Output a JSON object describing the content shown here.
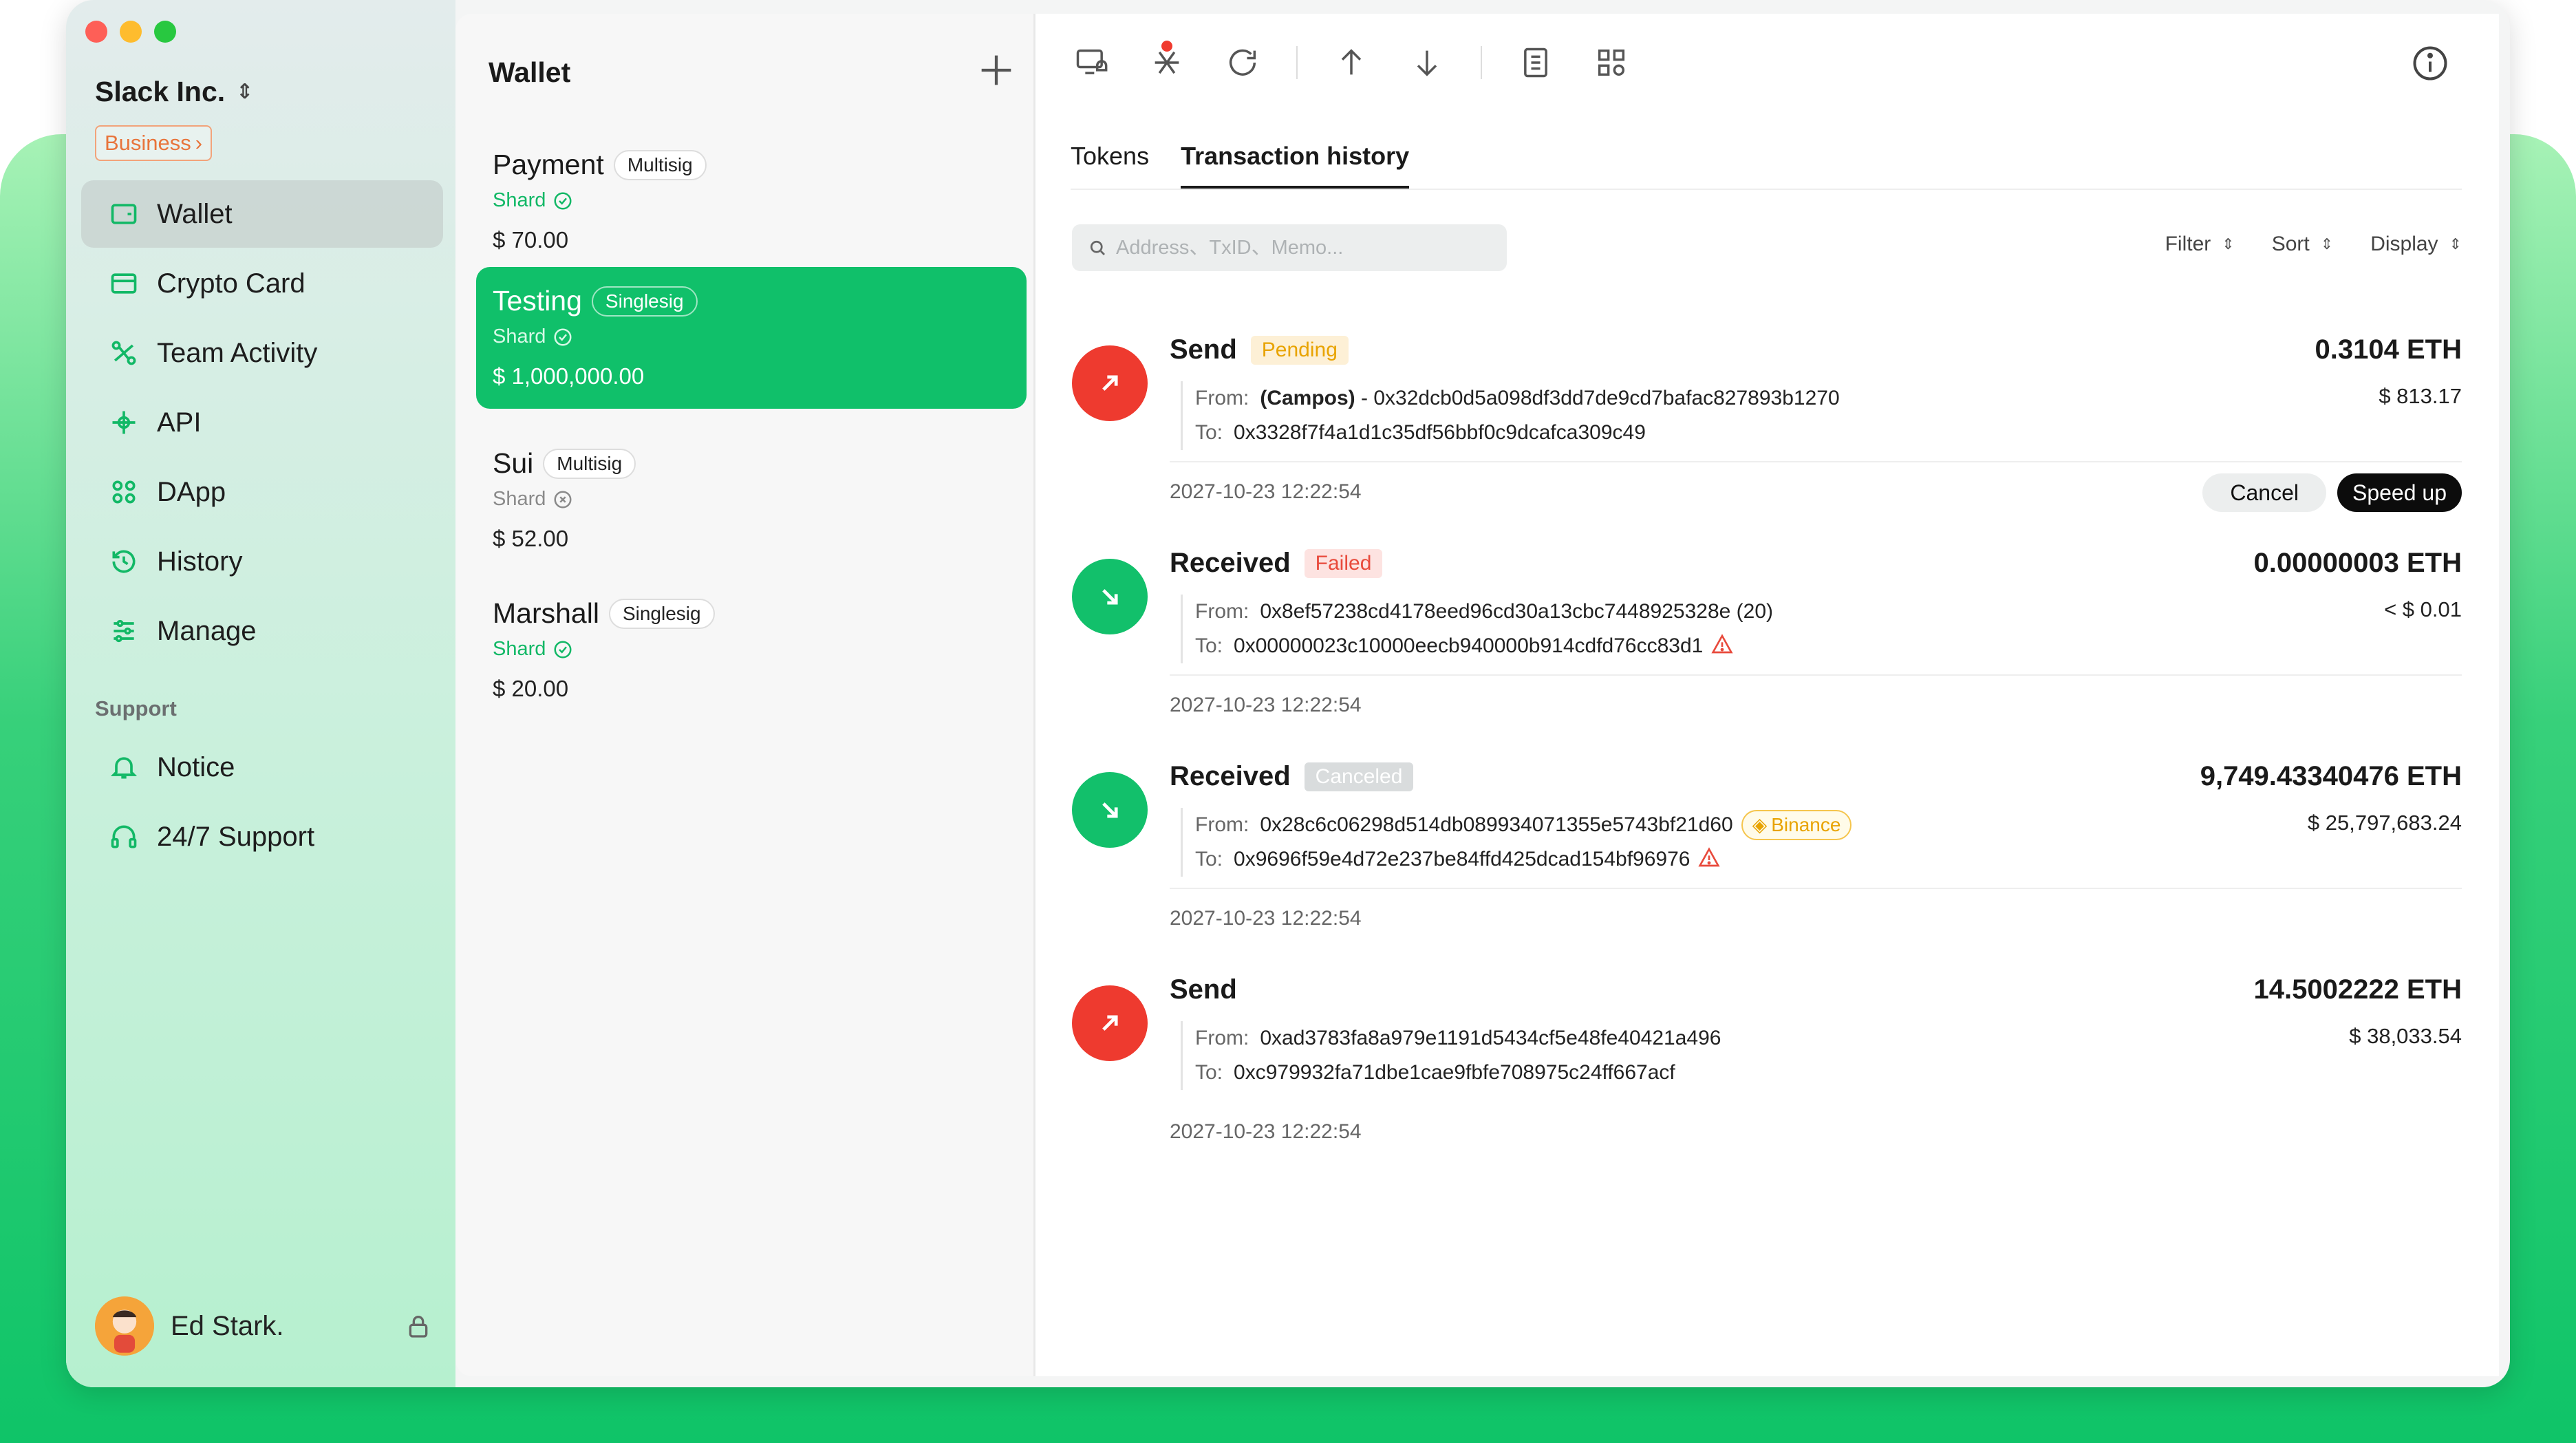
{
  "org": {
    "name": "Slack Inc.",
    "plan": "Business"
  },
  "sidebar": {
    "items": [
      {
        "label": "Wallet",
        "icon": "wallet-icon"
      },
      {
        "label": "Crypto Card",
        "icon": "card-icon"
      },
      {
        "label": "Team Activity",
        "icon": "team-activity-icon"
      },
      {
        "label": "API",
        "icon": "api-icon"
      },
      {
        "label": "DApp",
        "icon": "dapp-icon"
      },
      {
        "label": "History",
        "icon": "history-icon"
      },
      {
        "label": "Manage",
        "icon": "manage-icon"
      }
    ],
    "support_label": "Support",
    "support_items": [
      {
        "label": "Notice",
        "icon": "bell-icon"
      },
      {
        "label": "24/7 Support",
        "icon": "headset-icon"
      }
    ],
    "user": {
      "name": "Ed Stark."
    }
  },
  "wallet_panel": {
    "title": "Wallet",
    "wallets": [
      {
        "name": "Payment",
        "type": "Multisig",
        "shard": "Shard",
        "amount": "$ 70.00"
      },
      {
        "name": "Testing",
        "type": "Singlesig",
        "shard": "Shard",
        "amount": "$ 1,000,000.00"
      },
      {
        "name": "Sui",
        "type": "Multisig",
        "shard": "Shard",
        "amount": "$ 52.00"
      },
      {
        "name": "Marshall",
        "type": "Singlesig",
        "shard": "Shard",
        "amount": "$ 20.00"
      }
    ]
  },
  "main": {
    "tabs": [
      "Tokens",
      "Transaction history"
    ],
    "search_placeholder": "Address、TxID、Memo...",
    "controls": [
      "Filter",
      "Sort",
      "Display"
    ],
    "transactions": [
      {
        "type": "Send",
        "status": "Pending",
        "from_label": "From:",
        "from_name": "(Campos)",
        "from": "- 0x32dcb0d5a098df3dd7de9cd7bafac827893b1270",
        "to_label": "To:",
        "to": "0x3328f7f4a1d1c35df56bbf0c9dcafca309c49",
        "amount": "0.3104 ETH",
        "fiat": "$ 813.17",
        "time": "2027-10-23  12:22:54",
        "cancel_label": "Cancel",
        "speed_label": "Speed up"
      },
      {
        "type": "Received",
        "status": "Failed",
        "from_label": "From:",
        "from": "0x8ef57238cd4178eed96cd30a13cbc7448925328e (20)",
        "to_label": "To:",
        "to": "0x00000023c10000eecb940000b914cdfd76cc83d1",
        "amount": "0.00000003 ETH",
        "fiat": "< $ 0.01",
        "time": "2027-10-23  12:22:54"
      },
      {
        "type": "Received",
        "status": "Canceled",
        "from_label": "From:",
        "from": "0x28c6c06298d514db089934071355e5743bf21d60",
        "exchange": "Binance",
        "to_label": "To:",
        "to": "0x9696f59e4d72e237be84ffd425dcad154bf96976",
        "amount": "9,749.43340476 ETH",
        "fiat": "$ 25,797,683.24",
        "time": "2027-10-23  12:22:54"
      },
      {
        "type": "Send",
        "from_label": "From:",
        "from": "0xad3783fa8a979e1191d5434cf5e48fe40421a496",
        "to_label": "To:",
        "to": "0xc979932fa71dbe1cae9fbfe708975c24ff667acf",
        "amount": "14.5002222 ETH",
        "fiat": "$ 38,033.54",
        "time": "2027-10-23  12:22:54"
      }
    ]
  },
  "colors": {
    "accent_green": "#10c06a",
    "send_red": "#ee3a2f",
    "pending": "#e8a300",
    "failed": "#e84a3c",
    "business": "#e8743b"
  }
}
